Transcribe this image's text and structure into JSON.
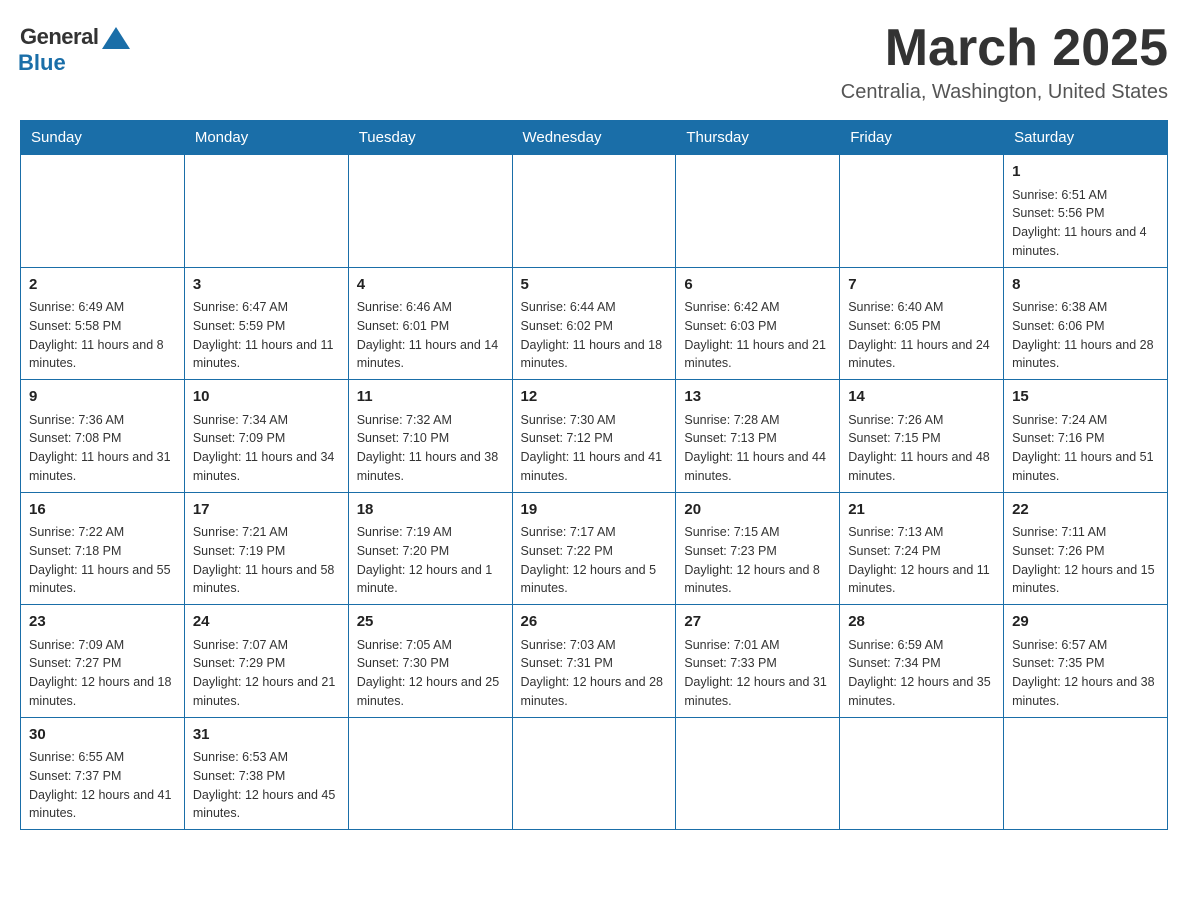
{
  "logo": {
    "general": "General",
    "blue": "Blue"
  },
  "header": {
    "month": "March 2025",
    "location": "Centralia, Washington, United States"
  },
  "days_of_week": [
    "Sunday",
    "Monday",
    "Tuesday",
    "Wednesday",
    "Thursday",
    "Friday",
    "Saturday"
  ],
  "weeks": [
    [
      {
        "day": "",
        "info": ""
      },
      {
        "day": "",
        "info": ""
      },
      {
        "day": "",
        "info": ""
      },
      {
        "day": "",
        "info": ""
      },
      {
        "day": "",
        "info": ""
      },
      {
        "day": "",
        "info": ""
      },
      {
        "day": "1",
        "info": "Sunrise: 6:51 AM\nSunset: 5:56 PM\nDaylight: 11 hours and 4 minutes."
      }
    ],
    [
      {
        "day": "2",
        "info": "Sunrise: 6:49 AM\nSunset: 5:58 PM\nDaylight: 11 hours and 8 minutes."
      },
      {
        "day": "3",
        "info": "Sunrise: 6:47 AM\nSunset: 5:59 PM\nDaylight: 11 hours and 11 minutes."
      },
      {
        "day": "4",
        "info": "Sunrise: 6:46 AM\nSunset: 6:01 PM\nDaylight: 11 hours and 14 minutes."
      },
      {
        "day": "5",
        "info": "Sunrise: 6:44 AM\nSunset: 6:02 PM\nDaylight: 11 hours and 18 minutes."
      },
      {
        "day": "6",
        "info": "Sunrise: 6:42 AM\nSunset: 6:03 PM\nDaylight: 11 hours and 21 minutes."
      },
      {
        "day": "7",
        "info": "Sunrise: 6:40 AM\nSunset: 6:05 PM\nDaylight: 11 hours and 24 minutes."
      },
      {
        "day": "8",
        "info": "Sunrise: 6:38 AM\nSunset: 6:06 PM\nDaylight: 11 hours and 28 minutes."
      }
    ],
    [
      {
        "day": "9",
        "info": "Sunrise: 7:36 AM\nSunset: 7:08 PM\nDaylight: 11 hours and 31 minutes."
      },
      {
        "day": "10",
        "info": "Sunrise: 7:34 AM\nSunset: 7:09 PM\nDaylight: 11 hours and 34 minutes."
      },
      {
        "day": "11",
        "info": "Sunrise: 7:32 AM\nSunset: 7:10 PM\nDaylight: 11 hours and 38 minutes."
      },
      {
        "day": "12",
        "info": "Sunrise: 7:30 AM\nSunset: 7:12 PM\nDaylight: 11 hours and 41 minutes."
      },
      {
        "day": "13",
        "info": "Sunrise: 7:28 AM\nSunset: 7:13 PM\nDaylight: 11 hours and 44 minutes."
      },
      {
        "day": "14",
        "info": "Sunrise: 7:26 AM\nSunset: 7:15 PM\nDaylight: 11 hours and 48 minutes."
      },
      {
        "day": "15",
        "info": "Sunrise: 7:24 AM\nSunset: 7:16 PM\nDaylight: 11 hours and 51 minutes."
      }
    ],
    [
      {
        "day": "16",
        "info": "Sunrise: 7:22 AM\nSunset: 7:18 PM\nDaylight: 11 hours and 55 minutes."
      },
      {
        "day": "17",
        "info": "Sunrise: 7:21 AM\nSunset: 7:19 PM\nDaylight: 11 hours and 58 minutes."
      },
      {
        "day": "18",
        "info": "Sunrise: 7:19 AM\nSunset: 7:20 PM\nDaylight: 12 hours and 1 minute."
      },
      {
        "day": "19",
        "info": "Sunrise: 7:17 AM\nSunset: 7:22 PM\nDaylight: 12 hours and 5 minutes."
      },
      {
        "day": "20",
        "info": "Sunrise: 7:15 AM\nSunset: 7:23 PM\nDaylight: 12 hours and 8 minutes."
      },
      {
        "day": "21",
        "info": "Sunrise: 7:13 AM\nSunset: 7:24 PM\nDaylight: 12 hours and 11 minutes."
      },
      {
        "day": "22",
        "info": "Sunrise: 7:11 AM\nSunset: 7:26 PM\nDaylight: 12 hours and 15 minutes."
      }
    ],
    [
      {
        "day": "23",
        "info": "Sunrise: 7:09 AM\nSunset: 7:27 PM\nDaylight: 12 hours and 18 minutes."
      },
      {
        "day": "24",
        "info": "Sunrise: 7:07 AM\nSunset: 7:29 PM\nDaylight: 12 hours and 21 minutes."
      },
      {
        "day": "25",
        "info": "Sunrise: 7:05 AM\nSunset: 7:30 PM\nDaylight: 12 hours and 25 minutes."
      },
      {
        "day": "26",
        "info": "Sunrise: 7:03 AM\nSunset: 7:31 PM\nDaylight: 12 hours and 28 minutes."
      },
      {
        "day": "27",
        "info": "Sunrise: 7:01 AM\nSunset: 7:33 PM\nDaylight: 12 hours and 31 minutes."
      },
      {
        "day": "28",
        "info": "Sunrise: 6:59 AM\nSunset: 7:34 PM\nDaylight: 12 hours and 35 minutes."
      },
      {
        "day": "29",
        "info": "Sunrise: 6:57 AM\nSunset: 7:35 PM\nDaylight: 12 hours and 38 minutes."
      }
    ],
    [
      {
        "day": "30",
        "info": "Sunrise: 6:55 AM\nSunset: 7:37 PM\nDaylight: 12 hours and 41 minutes."
      },
      {
        "day": "31",
        "info": "Sunrise: 6:53 AM\nSunset: 7:38 PM\nDaylight: 12 hours and 45 minutes."
      },
      {
        "day": "",
        "info": ""
      },
      {
        "day": "",
        "info": ""
      },
      {
        "day": "",
        "info": ""
      },
      {
        "day": "",
        "info": ""
      },
      {
        "day": "",
        "info": ""
      }
    ]
  ]
}
